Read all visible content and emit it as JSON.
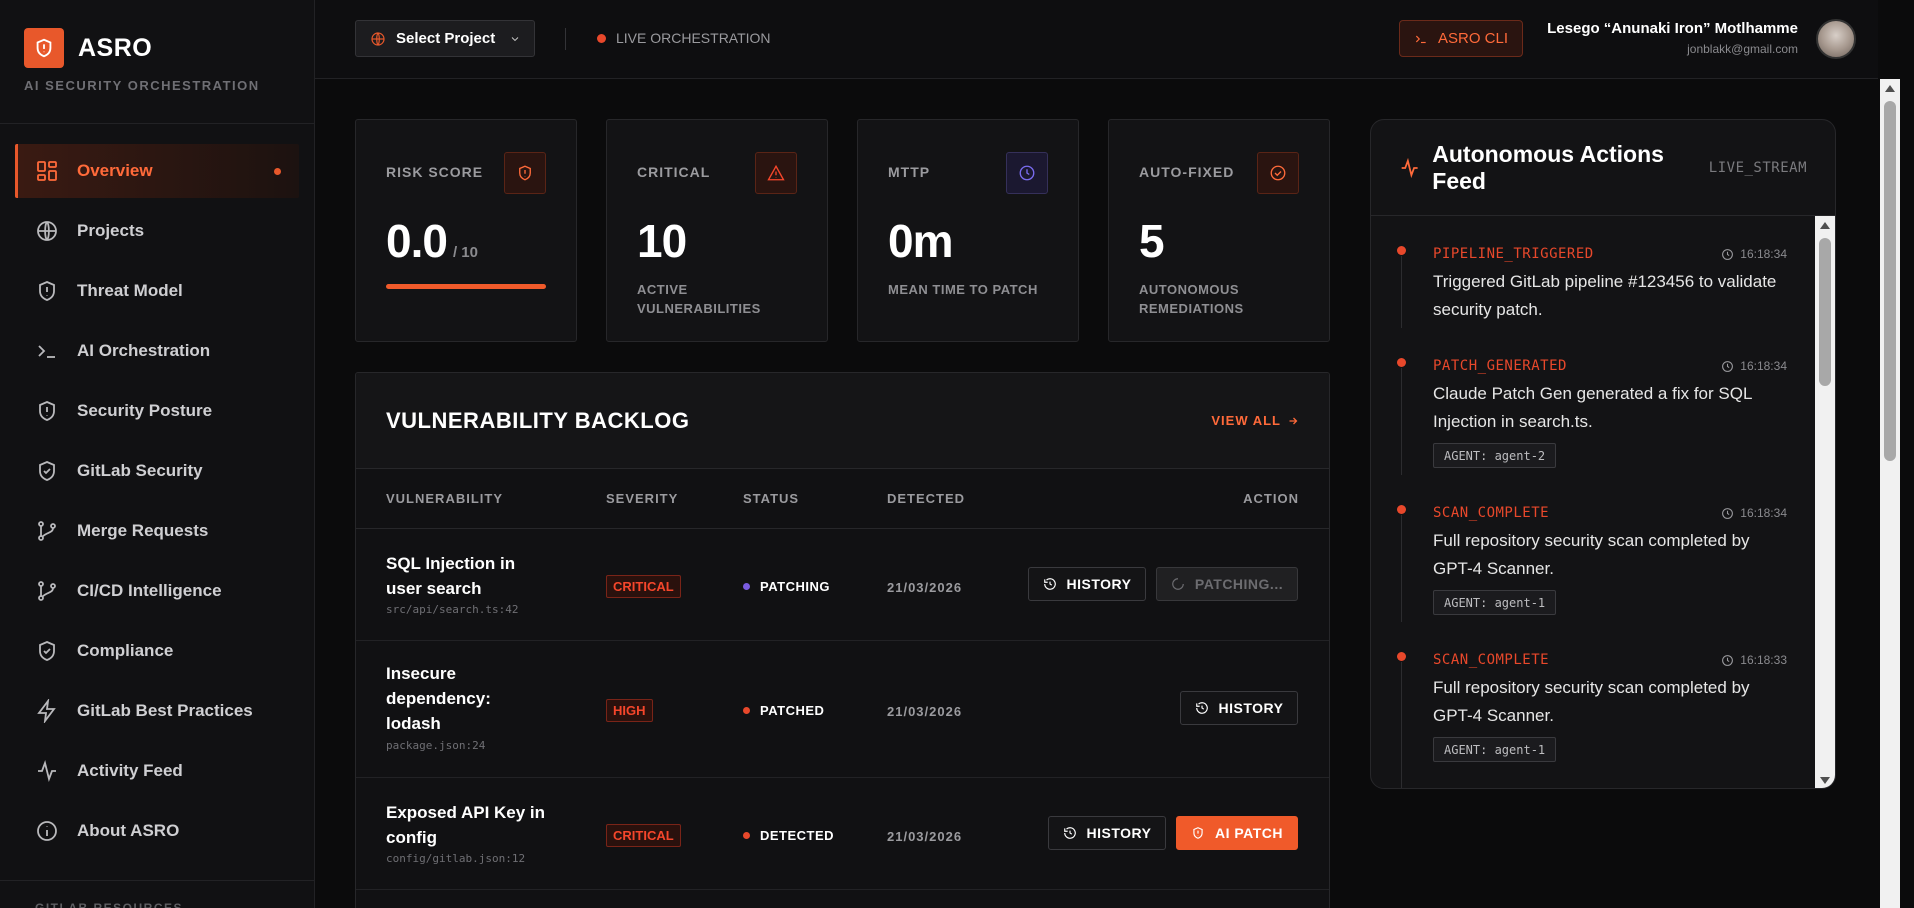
{
  "brand": {
    "name": "ASRO",
    "subtitle": "AI SECURITY ORCHESTRATION",
    "logo_icon": "shield-icon"
  },
  "sidebar": {
    "items": [
      {
        "label": "Overview",
        "icon": "grid-icon",
        "active": true
      },
      {
        "label": "Projects",
        "icon": "globe-icon"
      },
      {
        "label": "Threat Model",
        "icon": "shield-alert-icon"
      },
      {
        "label": "AI Orchestration",
        "icon": "terminal-icon"
      },
      {
        "label": "Security Posture",
        "icon": "shield-alert-icon"
      },
      {
        "label": "GitLab Security",
        "icon": "shield-check-icon"
      },
      {
        "label": "Merge Requests",
        "icon": "git-branch-icon"
      },
      {
        "label": "CI/CD Intelligence",
        "icon": "git-branch-icon"
      },
      {
        "label": "Compliance",
        "icon": "shield-check-icon"
      },
      {
        "label": "GitLab Best Practices",
        "icon": "zap-icon"
      },
      {
        "label": "Activity Feed",
        "icon": "activity-icon"
      },
      {
        "label": "About ASRO",
        "icon": "info-icon"
      }
    ],
    "footer_label": "GITLAB RESOURCES"
  },
  "header": {
    "project_select": "Select Project",
    "live_label": "LIVE ORCHESTRATION",
    "cli_button": "ASRO CLI",
    "user_name": "Lesego “Anunaki Iron” Motlhamme",
    "user_email": "jonblakk@gmail.com"
  },
  "stats": {
    "risk": {
      "label": "RISK SCORE",
      "value": "0.0",
      "suffix": "/ 10",
      "bar_fraction": 1.0
    },
    "critical": {
      "label": "CRITICAL",
      "value": "10",
      "sub": "ACTIVE VULNERABILITIES"
    },
    "mttp": {
      "label": "MTTP",
      "value": "0m",
      "sub": "MEAN TIME TO PATCH"
    },
    "autofixed": {
      "label": "AUTO-FIXED",
      "value": "5",
      "sub": "AUTONOMOUS REMEDIATIONS"
    }
  },
  "backlog": {
    "title": "VULNERABILITY BACKLOG",
    "view_all": "VIEW ALL",
    "columns": [
      "VULNERABILITY",
      "SEVERITY",
      "STATUS",
      "DETECTED",
      "ACTION"
    ],
    "rows": [
      {
        "title": "SQL Injection in user search",
        "file": "src/api/search.ts:42",
        "severity": "CRITICAL",
        "status": "PATCHING",
        "date": "21/03/2026",
        "history": "HISTORY",
        "action": "PATCHING..."
      },
      {
        "title": "Insecure dependency: lodash",
        "file": "package.json:24",
        "severity": "HIGH",
        "status": "PATCHED",
        "date": "21/03/2026",
        "history": "HISTORY"
      },
      {
        "title": "Exposed API Key in config",
        "file": "config/gitlab.json:12",
        "severity": "CRITICAL",
        "status": "DETECTED",
        "date": "21/03/2026",
        "history": "HISTORY",
        "action": "AI PATCH"
      }
    ]
  },
  "feed": {
    "title": "Autonomous Actions Feed",
    "tag": "LIVE_STREAM",
    "items": [
      {
        "type": "PIPELINE_TRIGGERED",
        "time": "16:18:34",
        "message": "Triggered GitLab pipeline #123456 to validate security patch."
      },
      {
        "type": "PATCH_GENERATED",
        "time": "16:18:34",
        "message": "Claude Patch Gen generated a fix for SQL Injection in search.ts.",
        "agent": "AGENT: agent-2"
      },
      {
        "type": "SCAN_COMPLETE",
        "time": "16:18:34",
        "message": "Full repository security scan completed by GPT-4 Scanner.",
        "agent": "AGENT: agent-1"
      },
      {
        "type": "SCAN_COMPLETE",
        "time": "16:18:33",
        "message": "Full repository security scan completed by GPT-4 Scanner.",
        "agent": "AGENT: agent-1"
      }
    ]
  },
  "colors": {
    "accent": "#f05a2a",
    "critical": "#f5462b",
    "patching": "#7a5ce0",
    "background": "#0b0b0c"
  }
}
